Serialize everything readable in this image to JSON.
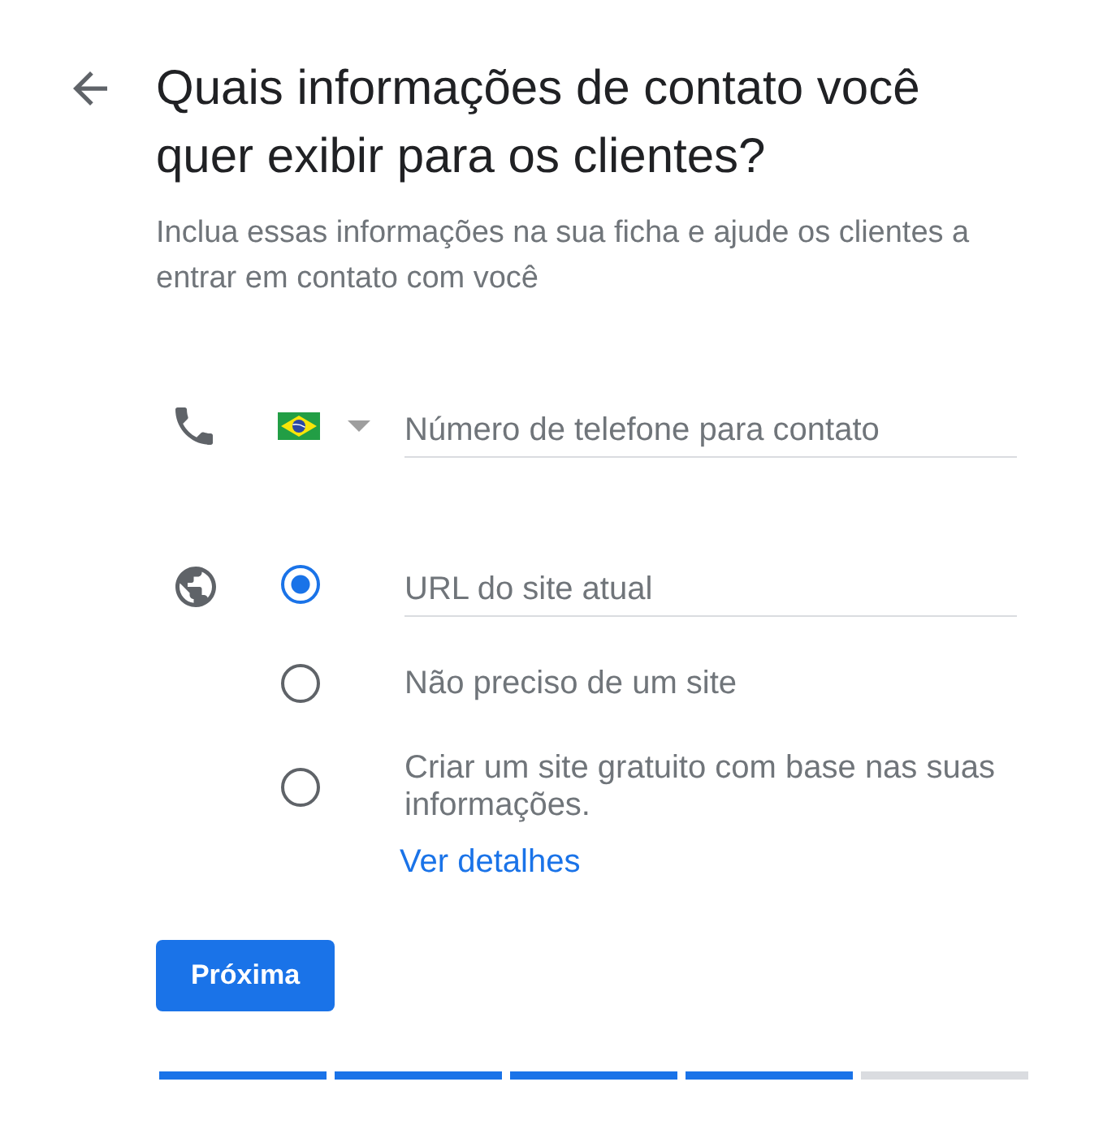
{
  "title": "Quais informações de contato você quer exibir para os clientes?",
  "subtitle": "Inclua essas informações na sua ficha e ajude os clientes a entrar em contato com você",
  "phone": {
    "placeholder": "Número de telefone para contato"
  },
  "website_options": [
    {
      "kind": "field",
      "selected": true,
      "placeholder": "URL do site atual"
    },
    {
      "kind": "label",
      "selected": false,
      "label": "Não preciso de um site"
    },
    {
      "kind": "label",
      "selected": false,
      "label": "Criar um site gratuito com base nas suas informações.",
      "link": "Ver detalhes"
    }
  ],
  "next_button": {
    "label": "Próxima"
  },
  "progress_steps": [
    {
      "complete": true
    },
    {
      "complete": true
    },
    {
      "complete": true
    },
    {
      "complete": true
    },
    {
      "complete": false
    }
  ]
}
